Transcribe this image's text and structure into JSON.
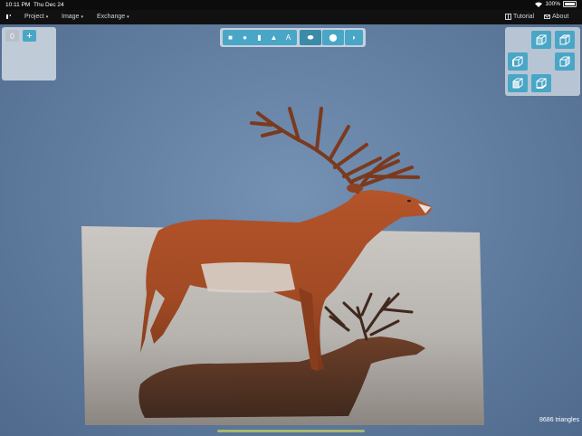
{
  "status": {
    "time": "10:11 PM",
    "date": "Thu Dec 24",
    "battery": "100%"
  },
  "menu": {
    "project": "Project",
    "image": "Image",
    "exchange": "Exchange",
    "tutorial": "Tutorial",
    "about": "About"
  },
  "left_panel": {
    "gray_button": "0",
    "add_button": "+"
  },
  "toolbar": {
    "square": "■",
    "circle": "●",
    "rect": "▮",
    "triangle": "▲",
    "text": "A",
    "mode1": "⬬",
    "mode2": "⬤",
    "mode3": "◗"
  },
  "footer": {
    "triangles": "8686 triangles"
  },
  "colors": {
    "accent": "#4aa6c6",
    "panel": "#d2dae4",
    "menubar": "#111111",
    "home_indicator": "#a9b86c"
  }
}
